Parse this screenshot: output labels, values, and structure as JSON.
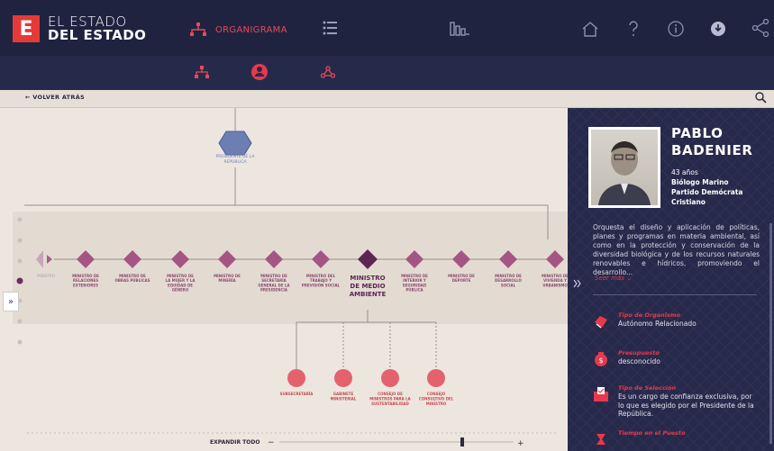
{
  "header": {
    "logo_letter": "E",
    "logo_line1": "EL ESTADO",
    "logo_line2": "DEL ESTADO",
    "nav_organigrama": "ORGANIGRAMA",
    "accent": "#e63a38",
    "icons": [
      "org-chart-icon",
      "list-icon",
      "stats-icon",
      "home-icon",
      "help-icon",
      "info-icon",
      "download-icon",
      "share-icon"
    ]
  },
  "back_label": "← VOLVER ATRÁS",
  "chart": {
    "president_label": [
      "PRESIDENTE DE LA",
      "REPÚBLICA"
    ],
    "ministries": [
      [
        "MINISTRO DE",
        "RELACIONES",
        "EXTERIORES"
      ],
      [
        "MINISTRO DE",
        "OBRAS PÚBLICAS"
      ],
      [
        "MINISTRO DE",
        "LA MUJER Y LA",
        "EQUIDAD DE",
        "GÉNERO"
      ],
      [
        "MINISTRO DE",
        "MINERÍA"
      ],
      [
        "MINISTRO DE",
        "SECRETARÍA",
        "GENERAL DE LA",
        "PRESIDENCIA"
      ],
      [
        "MINISTRO DEL",
        "TRABAJO Y",
        "PREVISIÓN SOCIAL"
      ],
      [
        "MINISTRO",
        "DE MEDIO",
        "AMBIENTE"
      ],
      [
        "MINISTRO DE",
        "INTERIOR Y",
        "SEGURIDAD",
        "PÚBLICA"
      ],
      [
        "MINISTRO DE",
        "DEPORTE"
      ],
      [
        "MINISTRO DE",
        "DESARROLLO",
        "SOCIAL"
      ],
      [
        "MINISTRO DE",
        "VIVIENDA Y",
        "URBANISMO"
      ]
    ],
    "first_label": "MINISTRO",
    "children": [
      [
        "SUBSECRETARÍA"
      ],
      [
        "GABINETE",
        "MINISTERIAL"
      ],
      [
        "CONSEJO DE",
        "MINISTROS PARA LA",
        "SUSTENTABILIDAD"
      ],
      [
        "CONSEJO",
        "CONSULTIVO DEL",
        "MINISTRO"
      ]
    ],
    "expand_label": "EXPANDIR TODO",
    "zoom_minus": "−",
    "zoom_plus": "+"
  },
  "panel": {
    "name1": "PABLO",
    "name2": "BADENIER",
    "age": "43 años",
    "profession": "Biólogo Marino",
    "party1": "Partido Demócrata",
    "party2": "Cristiano",
    "description": "Orquesta el diseño y aplicación de políticas, planes y programas en materia ambiental, así como en la protección y conservación de la diversidad biológica y de los recursos naturales renovables e hídricos, promoviendo el desarrollo...",
    "ver_mas": "Seer más ⌄",
    "tipo_org_title": "Tipo de Organismo",
    "tipo_org_value": "Autónomo Relacionado",
    "presupuesto_title": "Presupuesto",
    "presupuesto_value": "desconocido",
    "seleccion_title": "Tipo de Selección",
    "seleccion_value": "Es un cargo de confianza exclusiva, por lo que es elegido por el Presidente de la República.",
    "tiempo_title": "Tiempo en el Puesto"
  }
}
